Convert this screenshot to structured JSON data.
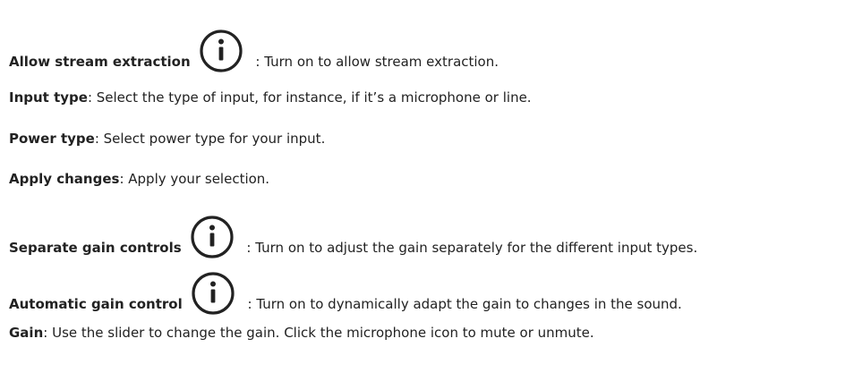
{
  "items": [
    {
      "term": "Allow stream extraction",
      "separator": " : ",
      "description": "Turn on to allow stream extraction.",
      "has_info_icon": true
    },
    {
      "term": "Input type",
      "separator": ": ",
      "description": "Select the type of input, for instance, if it’s a microphone or line.",
      "has_info_icon": false
    },
    {
      "term": "Power type",
      "separator": ": ",
      "description": "Select power type for your input.",
      "has_info_icon": false
    },
    {
      "term": "Apply changes",
      "separator": ": ",
      "description": "Apply your selection.",
      "has_info_icon": false
    },
    {
      "term": "Separate gain controls",
      "separator": " : ",
      "description": "Turn on to adjust the gain separately for the different input types.",
      "has_info_icon": true
    },
    {
      "term": "Automatic gain control",
      "separator": " : ",
      "description": "Turn on to dynamically adapt the gain to changes in the sound.",
      "has_info_icon": true
    },
    {
      "term": "Gain",
      "separator": ": ",
      "description": "Use the slider to change the gain. Click the microphone icon to mute or unmute.",
      "has_info_icon": false
    }
  ],
  "icon_name": "info-icon",
  "colors": {
    "text": "#222222",
    "icon": "#222222"
  }
}
